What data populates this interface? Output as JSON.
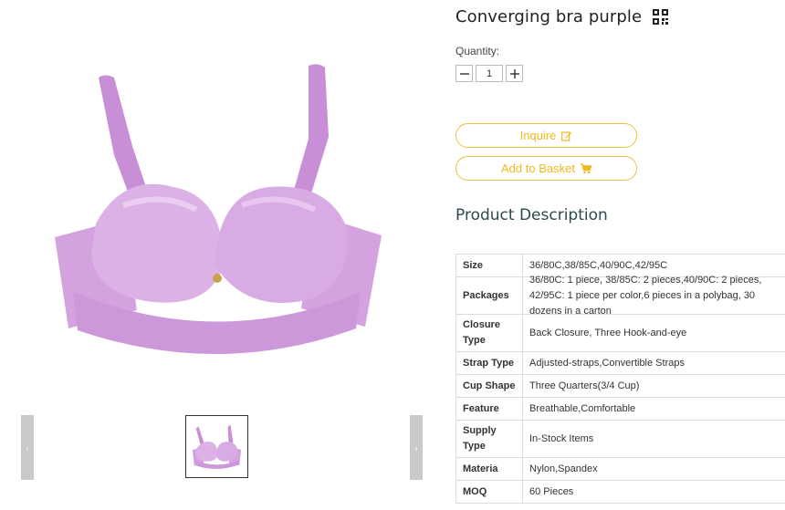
{
  "product": {
    "title": "Converging bra purple",
    "qr_icon": "qr-code-icon"
  },
  "quantity": {
    "label": "Quantity:",
    "value": "1",
    "minus_icon": "minus-icon",
    "plus_icon": "plus-icon"
  },
  "actions": {
    "inquire_label": "Inquire",
    "inquire_icon": "edit-icon",
    "basket_label": "Add to Basket",
    "basket_icon": "cart-icon"
  },
  "gallery": {
    "prev_icon": "chevron-left-icon",
    "next_icon": "chevron-right-icon",
    "prev_glyph": "‹",
    "next_glyph": "›"
  },
  "description": {
    "title": "Product Description",
    "specs": [
      {
        "key": "Size",
        "value": "36/80C,38/85C,40/90C,42/95C"
      },
      {
        "key": "Packages",
        "value": "36/80C: 1 piece, 38/85C: 2 pieces,40/90C: 2 pieces, 42/95C: 1 piece per color,6 pieces in a polybag, 30 dozens in a carton"
      },
      {
        "key": "Closure Type",
        "value": "Back Closure, Three Hook-and-eye"
      },
      {
        "key": "Strap Type",
        "value": "Adjusted-straps,Convertible Straps"
      },
      {
        "key": "Cup Shape",
        "value": "Three Quarters(3/4 Cup)"
      },
      {
        "key": "Feature",
        "value": "Breathable,Comfortable"
      },
      {
        "key": "Supply Type",
        "value": "In-Stock Items"
      },
      {
        "key": "Materia",
        "value": "Nylon,Spandex"
      },
      {
        "key": "MOQ",
        "value": "60 Pieces"
      }
    ]
  },
  "colors": {
    "accent": "#f0b81e",
    "product": "#d6a6e0",
    "heading": "#2c4a4f"
  }
}
